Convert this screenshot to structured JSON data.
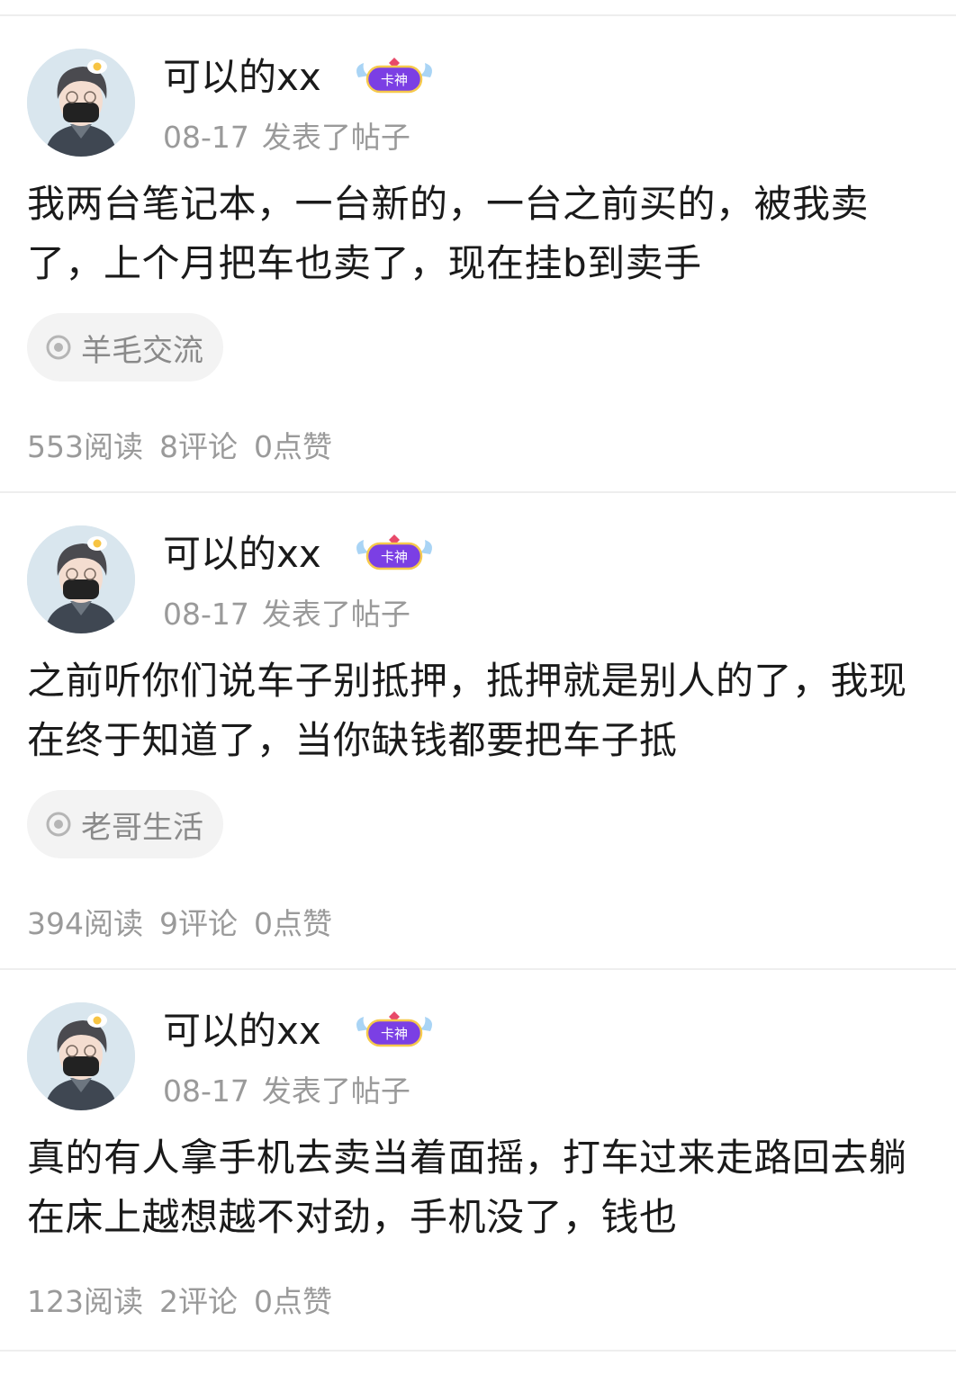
{
  "posts": [
    {
      "author": "可以的xx",
      "badge_label": "卡神",
      "date": "08-17",
      "action": "发表了帖子",
      "content": "我两台笔记本，一台新的，一台之前买的，被我卖了，上个月把车也卖了，现在挂b到卖手",
      "tag": {
        "icon": "target-icon",
        "label": "羊毛交流"
      },
      "stats": {
        "reads": "553阅读",
        "comments": "8评论",
        "likes": "0点赞"
      }
    },
    {
      "author": "可以的xx",
      "badge_label": "卡神",
      "date": "08-17",
      "action": "发表了帖子",
      "content": "之前听你们说车子别抵押，抵押就是别人的了，我现在终于知道了，当你缺钱都要把车子抵",
      "tag": {
        "icon": "target-icon",
        "label": "老哥生活"
      },
      "stats": {
        "reads": "394阅读",
        "comments": "9评论",
        "likes": "0点赞"
      }
    },
    {
      "author": "可以的xx",
      "badge_label": "卡神",
      "date": "08-17",
      "action": "发表了帖子",
      "content": "真的有人拿手机去卖当着面摇，打车过来走路回去躺在床上越想越不对劲，手机没了，钱也",
      "tag": null,
      "stats": {
        "reads": "123阅读",
        "comments": "2评论",
        "likes": "0点赞"
      }
    }
  ],
  "colors": {
    "text_primary": "#1a1a1a",
    "text_secondary": "#9a9a9a",
    "tag_background": "#f3f3f3",
    "divider": "#eeeeee",
    "badge_purple": "#7b3fe4"
  }
}
